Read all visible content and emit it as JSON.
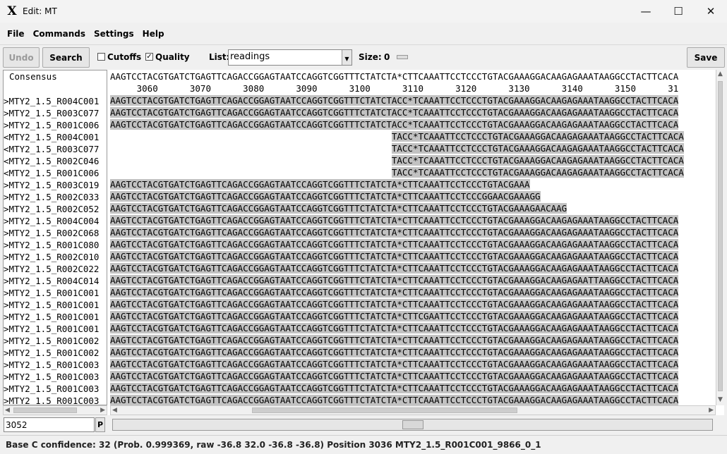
{
  "window": {
    "title": "Edit: MT",
    "app_icon": "x-icon"
  },
  "menu": [
    "File",
    "Commands",
    "Settings",
    "Help"
  ],
  "toolbar": {
    "undo_label": "Undo",
    "search_label": "Search",
    "cutoffs_label": "Cutoffs",
    "cutoffs_checked": false,
    "quality_label": "Quality",
    "quality_checked": true,
    "list_label": "List:",
    "list_value": "readings",
    "size_label": "Size:",
    "size_value": "0",
    "save_label": "Save"
  },
  "editor": {
    "consensus_label": "Consensus",
    "consensus_seq": "AAGTCCTACGTGATCTGAGTTCAGACCGGAGTAATCCAGGTCGGTTTCTATCTA*CTTCAAATTCCTCCCTGTACGAAAGGACAAGAGAAATAAGGCCTACTTCACA",
    "ruler": "     3060      3070      3080      3090      3100      3110      3120      3130      3140      3150      31",
    "reads": [
      {
        "name": ">MTY2_1.5_R004C001",
        "seq": "AAGTCCTACGTGATCTGAGTTCAGACCGGAGTAATCCAGGTCGGTTTCTATCTACC*TCAAATTCCTCCCTGTACGAAAGGACAAGAGAAATAAGGCCTACTTCACA"
      },
      {
        "name": ">MTY2_1.5_R003C077",
        "seq": "AAGTCCTACGTGATCTGAGTTCAGACCGGAGTAATCCAGGTCGGTTTCTATCTACC*TCAAATTCCTCCCTGTACGAAAGGACAAGAGAAATAAGGCCTACTTCACA"
      },
      {
        "name": ">MTY2_1.5_R001C006",
        "seq": "AAGTCCTACGTGATCTGAGTTCAGACCGGAGTAATCCAGGTCGGTTTCTATCTACC*TCAAATTCCTCCCTGTACGAAAGGACAAGAGAAATAAGGCCTACTTCACA"
      },
      {
        "name": "<MTY2_1.5_R004C001",
        "seq": "                                                     TACC*TCAAATTCCTCCCTGTACGAAAGGACAAGAGAAATAAGGCCTACTTCACA"
      },
      {
        "name": "<MTY2_1.5_R003C077",
        "seq": "                                                     TACC*TCAAATTCCTCCCTGTACGAAAGGACAAGAGAAATAAGGCCTACTTCACA"
      },
      {
        "name": "<MTY2_1.5_R002C046",
        "seq": "                                                     TACC*TCAAATTCCTCCCTGTACGAAAGGACAAGAGAAATAAGGCCTACTTCACA"
      },
      {
        "name": "<MTY2_1.5_R001C006",
        "seq": "                                                     TACC*TCAAATTCCTCCCTGTACGAAAGGACAAGAGAAATAAGGCCTACTTCACA"
      },
      {
        "name": ">MTY2_1.5_R003C019",
        "seq": "AAGTCCTACGTGATCTGAGTTCAGACCGGAGTAATCCAGGTCGGTTTCTATCTA*CTTCAAATTCCTCCCTGTACGAAA"
      },
      {
        "name": ">MTY2_1.5_R002C033",
        "seq": "AAGTCCTACGTGATCTGAGTTCAGACCGGAGTAATCCAGGTCGGTTTCTATCTA*CTTCAAATTCCTCCCGGAACGAAAGG"
      },
      {
        "name": ">MTY2_1.5_R002C052",
        "seq": "AAGTCCTACGTGATCTGAGTTCAGACCGGAGTAATCCAGGTCGGTTTCTATCTA*CTTCAAATTCCTCCCTGTACGAAAGAACAAG"
      },
      {
        "name": ">MTY2_1.5_R004C004",
        "seq": "AAGTCCTACGTGATCTGAGTTCAGACCGGAGTAATCCAGGTCGGTTTCTATCTA*CTTCAAATTCCTCCCTGTACGAAAGGACAAGAGAAATAAGGCCTACTTCACA"
      },
      {
        "name": ">MTY2_1.5_R002C068",
        "seq": "AAGTCCTACGTGATCTGAGTTCAGACCGGAGTAATCCAGGTCGGTTTCTATCTA*CTTCAAATTCCTCCCTGTACGAAAGGACAAGAGAAATAAGGCCTACTTCACA"
      },
      {
        "name": ">MTY2_1.5_R001C080",
        "seq": "AAGTCCTACGTGATCTGAGTTCAGACCGGAGTAATCCAGGTCGGTTTCTATCTA*CTTCAAATTCCTCCCTGTACGAAAGGACAAGAGAAATAAGGCCTACTTCACA"
      },
      {
        "name": ">MTY2_1.5_R002C010",
        "seq": "AAGTCCTACGTGATCTGAGTTCAGACCGGAGTAATCCAGGTCGGTTTCTATCTA*CTTCAAATTCCTCCCTGTACGAAAGGACAAGAGAAATAAGGCCTACTTCACA"
      },
      {
        "name": ">MTY2_1.5_R002C022",
        "seq": "AAGTCCTACGTGATCTGAGTTCAGACCGGAGTAATCCAGGTCGGTTTCTATCTA*CTTCAAATTCCTCCCTGTACGAAAGGACAAGAGAAATAAGGCCTACTTCACA"
      },
      {
        "name": ">MTY2_1.5_R004C014",
        "seq": "AAGTCCTACGTGATCTGAGTTCAGACCGGAGTAATCCAGGTCGGTTTCTATCTA*CTTCAAATTCCTCCCTGTACGAAAGGACAAGAGAATTAAGGCCTACTTCACA"
      },
      {
        "name": ">MTY2_1.5_R001C001",
        "seq": "AAGTCCTACGTGATCTGAGTTCAGACCGGAGTAATCCAGGTCGGTTTCTATCTA*CTTCAAATTCCTCCCTGTACGAAAGGACAAGAGAAATAAGGCCTACTTCACA"
      },
      {
        "name": ">MTY2_1.5_R001C001",
        "seq": "AAGTCCTACGTGATCTGAGTTCAGACCGGAGTAATCCAGGTCGGTTTCTATCTA*CTTCAAATTCCTCCCTGTACGAAAGGACAAGAGAAATAAGGCCTACTTCACA"
      },
      {
        "name": ">MTY2_1.5_R001C001",
        "seq": "AAGTCCTACGTGATCTGAGTTCAGACCGGAGTAATCCAGGTCGGTTTCTATCTA*CTTCGAATTCCTCCCTGTACGAAAGGACAAGAGAAATAAGGCCTACTTCACA"
      },
      {
        "name": ">MTY2_1.5_R001C001",
        "seq": "AAGTCCTACGTGATCTGAGTTCAGACCGGAGTAATCCAGGTCGGTTTCTATCTA*CTTCAAATTCCTCCCTGTACGAAAGGACAAGAGAAATAAGGCCTACTTCACA"
      },
      {
        "name": ">MTY2_1.5_R001C002",
        "seq": "AAGTCCTACGTGATCTGAGTTCAGACCGGAGTAATCCAGGTCGGTTTCTATCTA*CTTCAAATTCCTCCCTGTACGAAAGGACAAGAGAAATAAGGCCTACTTCACA"
      },
      {
        "name": ">MTY2_1.5_R001C002",
        "seq": "AAGTCCTACGTGATCTGAGTTCAGACCGGAGTAATCCAGGTCGGTTTCTATCTA*CTTCAAATTCCTCCCTGTACGAAAGGACAAGAGAAATAAGGCCTACTTCACA"
      },
      {
        "name": ">MTY2_1.5_R001C003",
        "seq": "AAGTCCTACGTGATCTGAGTTCAGACCGGAGTAATCCAGGTCGGTTTCTATCTA*CTTCAAATTCCTCCCTGTACGAAAGGACAAGAGAAATAAGGCCTACTTCACA"
      },
      {
        "name": ">MTY2_1.5_R001C003",
        "seq": "AAGTCCTACGTGATCTGAGTTCAGACCGGAGTAATCCAGGTCGGTTTCTATCTA*CTTCAAATTCCTCCCTGTACGAAAGGACAAGAGAAATAAGGCCTACTTCACA"
      },
      {
        "name": ">MTY2_1.5_R001C003",
        "seq": "AAGTCCTACGTGATCTGAGTTCAGACCGGAGTAATCCAGGTCGGTTTCTATCTA*CTTCAAATTCCTCCCTGTACGAAAGGACAAGAGAAATAAGGCCTACTTCACA"
      },
      {
        "name": ">MTY2_1.5_R001C003",
        "seq": "AAGTCCTACGTGATCTGAGTTCAGACCGGAGTAATCCAGGTCGGTTTCTATCTA*CTTCAAATTCCTCCCTGTACGAAAGGACAAGAGAAATAAGGCCTACTTCACA"
      }
    ]
  },
  "bottom": {
    "position_value": "3052",
    "p_label": "P"
  },
  "status": "Base C confidence: 32 (Prob. 0.999369, raw -36.8 32.0 -36.8 -36.8) Position 3036 MTY2_1.5_R001C001_9866_0_1",
  "colors": {
    "highlight_blue": "#8888ff",
    "read_bg": "#c2c2c2",
    "dark_hl": "#6e6e6e"
  }
}
